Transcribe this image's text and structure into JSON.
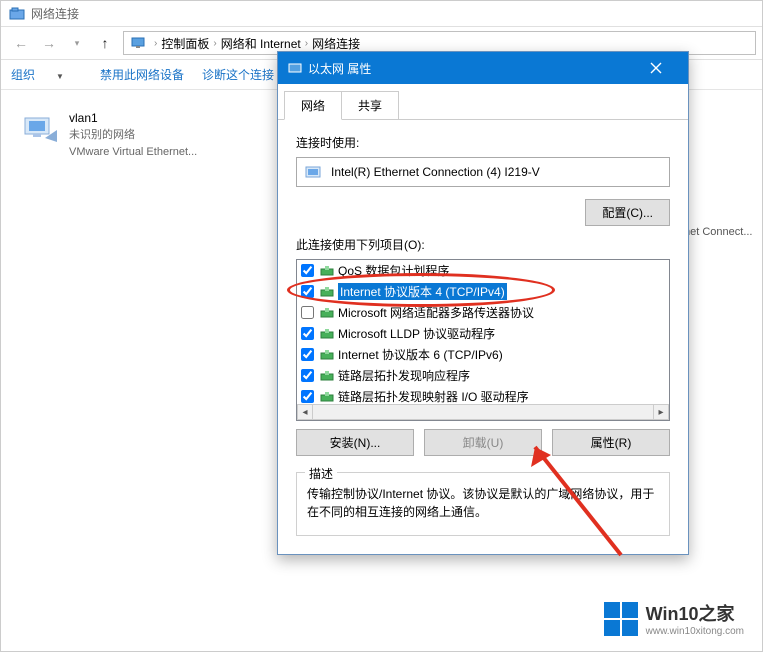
{
  "window": {
    "title_small": "网络连接"
  },
  "breadcrumb": {
    "items": [
      "控制面板",
      "网络和 Internet",
      "网络连接"
    ]
  },
  "toolbar": {
    "organize": "组织",
    "disable": "禁用此网络设备",
    "diagnose_truncated": "诊断这个连接"
  },
  "adapter_card": {
    "name": "vlan1",
    "status": "未识别的网络",
    "device": "VMware Virtual Ethernet..."
  },
  "right_peek_text": "net Connect...",
  "dialog": {
    "title": "以太网 属性",
    "tabs": {
      "network": "网络",
      "sharing": "共享"
    },
    "connect_using_label": "连接时使用:",
    "adapter_name": "Intel(R) Ethernet Connection (4) I219-V",
    "configure_btn": "配置(C)...",
    "items_label": "此连接使用下列项目(O):",
    "list": [
      {
        "checked": true,
        "label": "QoS 数据包计划程序"
      },
      {
        "checked": true,
        "label": "Internet 协议版本 4 (TCP/IPv4)",
        "selected": true
      },
      {
        "checked": false,
        "label": "Microsoft 网络适配器多路传送器协议"
      },
      {
        "checked": true,
        "label": "Microsoft LLDP 协议驱动程序"
      },
      {
        "checked": true,
        "label": "Internet 协议版本 6 (TCP/IPv6)"
      },
      {
        "checked": true,
        "label": "链路层拓扑发现响应程序"
      },
      {
        "checked": true,
        "label": "链路层拓扑发现映射器 I/O 驱动程序"
      }
    ],
    "install_btn": "安装(N)...",
    "uninstall_btn": "卸载(U)",
    "properties_btn": "属性(R)",
    "desc_legend": "描述",
    "desc_text": "传输控制协议/Internet 协议。该协议是默认的广域网络协议，用于在不同的相互连接的网络上通信。"
  },
  "watermark": {
    "title": "Win10之家",
    "url": "www.win10xitong.com"
  }
}
